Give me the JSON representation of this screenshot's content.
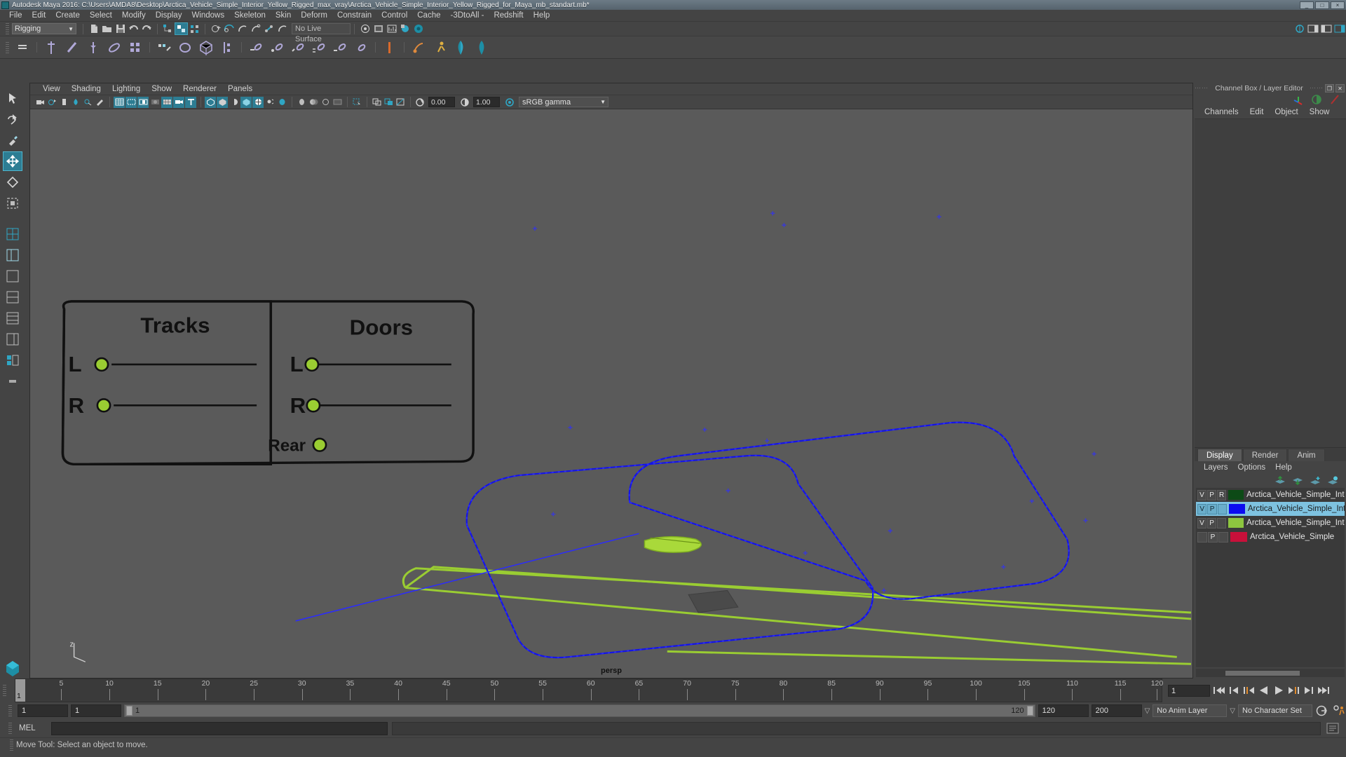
{
  "window": {
    "title": "Autodesk Maya 2016: C:\\Users\\AMDA8\\Desktop\\Arctica_Vehicle_Simple_Interior_Yellow_Rigged_max_vray\\Arctica_Vehicle_Simple_Interior_Yellow_Rigged_for_Maya_mb_standart.mb*",
    "minimize": "_",
    "maximize": "□",
    "close": "×"
  },
  "menubar": {
    "items": [
      "File",
      "Edit",
      "Create",
      "Select",
      "Modify",
      "Display",
      "Windows",
      "Skeleton",
      "Skin",
      "Deform",
      "Constrain",
      "Control",
      "Cache",
      "-3DtoAll -",
      "Redshift",
      "Help"
    ]
  },
  "toolbar": {
    "mode": "Rigging",
    "mode_arrow": "▼",
    "live_surface": "No Live Surface"
  },
  "viewport": {
    "menus": [
      "View",
      "Shading",
      "Lighting",
      "Show",
      "Renderer",
      "Panels"
    ],
    "exposure": "0.00",
    "gamma_value": "1.00",
    "color_management": "sRGB gamma",
    "color_arrow": "▼",
    "camera_label": "persp",
    "controls": {
      "tracks_title": "Tracks",
      "doors_title": "Doors",
      "track_l": "L",
      "track_r": "R",
      "door_l": "L",
      "door_r": "R",
      "door_rear": "Rear"
    }
  },
  "channel_box": {
    "title": "Channel Box / Layer Editor",
    "menus": [
      "Channels",
      "Edit",
      "Object",
      "Show"
    ]
  },
  "layer_editor": {
    "tabs": [
      "Display",
      "Render",
      "Anim"
    ],
    "active_tab": "Display",
    "menus": [
      "Layers",
      "Options",
      "Help"
    ],
    "layers": [
      {
        "v": "V",
        "p": "P",
        "r": "R",
        "color": "#0d4a16",
        "name": "Arctica_Vehicle_Simple_Interi",
        "selected": false,
        "r_visible": true
      },
      {
        "v": "V",
        "p": "P",
        "r": "",
        "color": "#0b0bf0",
        "name": "Arctica_Vehicle_Simple_Inte",
        "selected": true,
        "r_visible": false
      },
      {
        "v": "V",
        "p": "P",
        "r": "",
        "color": "#8dc63f",
        "name": "Arctica_Vehicle_Simple_Interi",
        "selected": false,
        "r_visible": false
      },
      {
        "v": "",
        "p": "P",
        "r": "",
        "color": "#c8103a",
        "name": "Arctica_Vehicle_Simple",
        "selected": false,
        "r_visible": false
      }
    ]
  },
  "timeline": {
    "current_frame": "1",
    "ticks": [
      5,
      10,
      15,
      20,
      25,
      30,
      35,
      40,
      45,
      50,
      55,
      60,
      65,
      70,
      75,
      80,
      85,
      90,
      95,
      100,
      105,
      110,
      115,
      120
    ],
    "start": 1,
    "end": 120,
    "frame_field": "1"
  },
  "range": {
    "anim_start": "1",
    "range_start": "1",
    "slider_start": "1",
    "slider_end": "120",
    "range_end": "120",
    "anim_end": "200",
    "anim_layer": "No Anim Layer",
    "character_set": "No Character Set",
    "dropdown_arrow": "▽"
  },
  "command_line": {
    "label": "MEL",
    "input_value": "",
    "output_value": ""
  },
  "status": {
    "message": "Move Tool: Select an object to move."
  }
}
